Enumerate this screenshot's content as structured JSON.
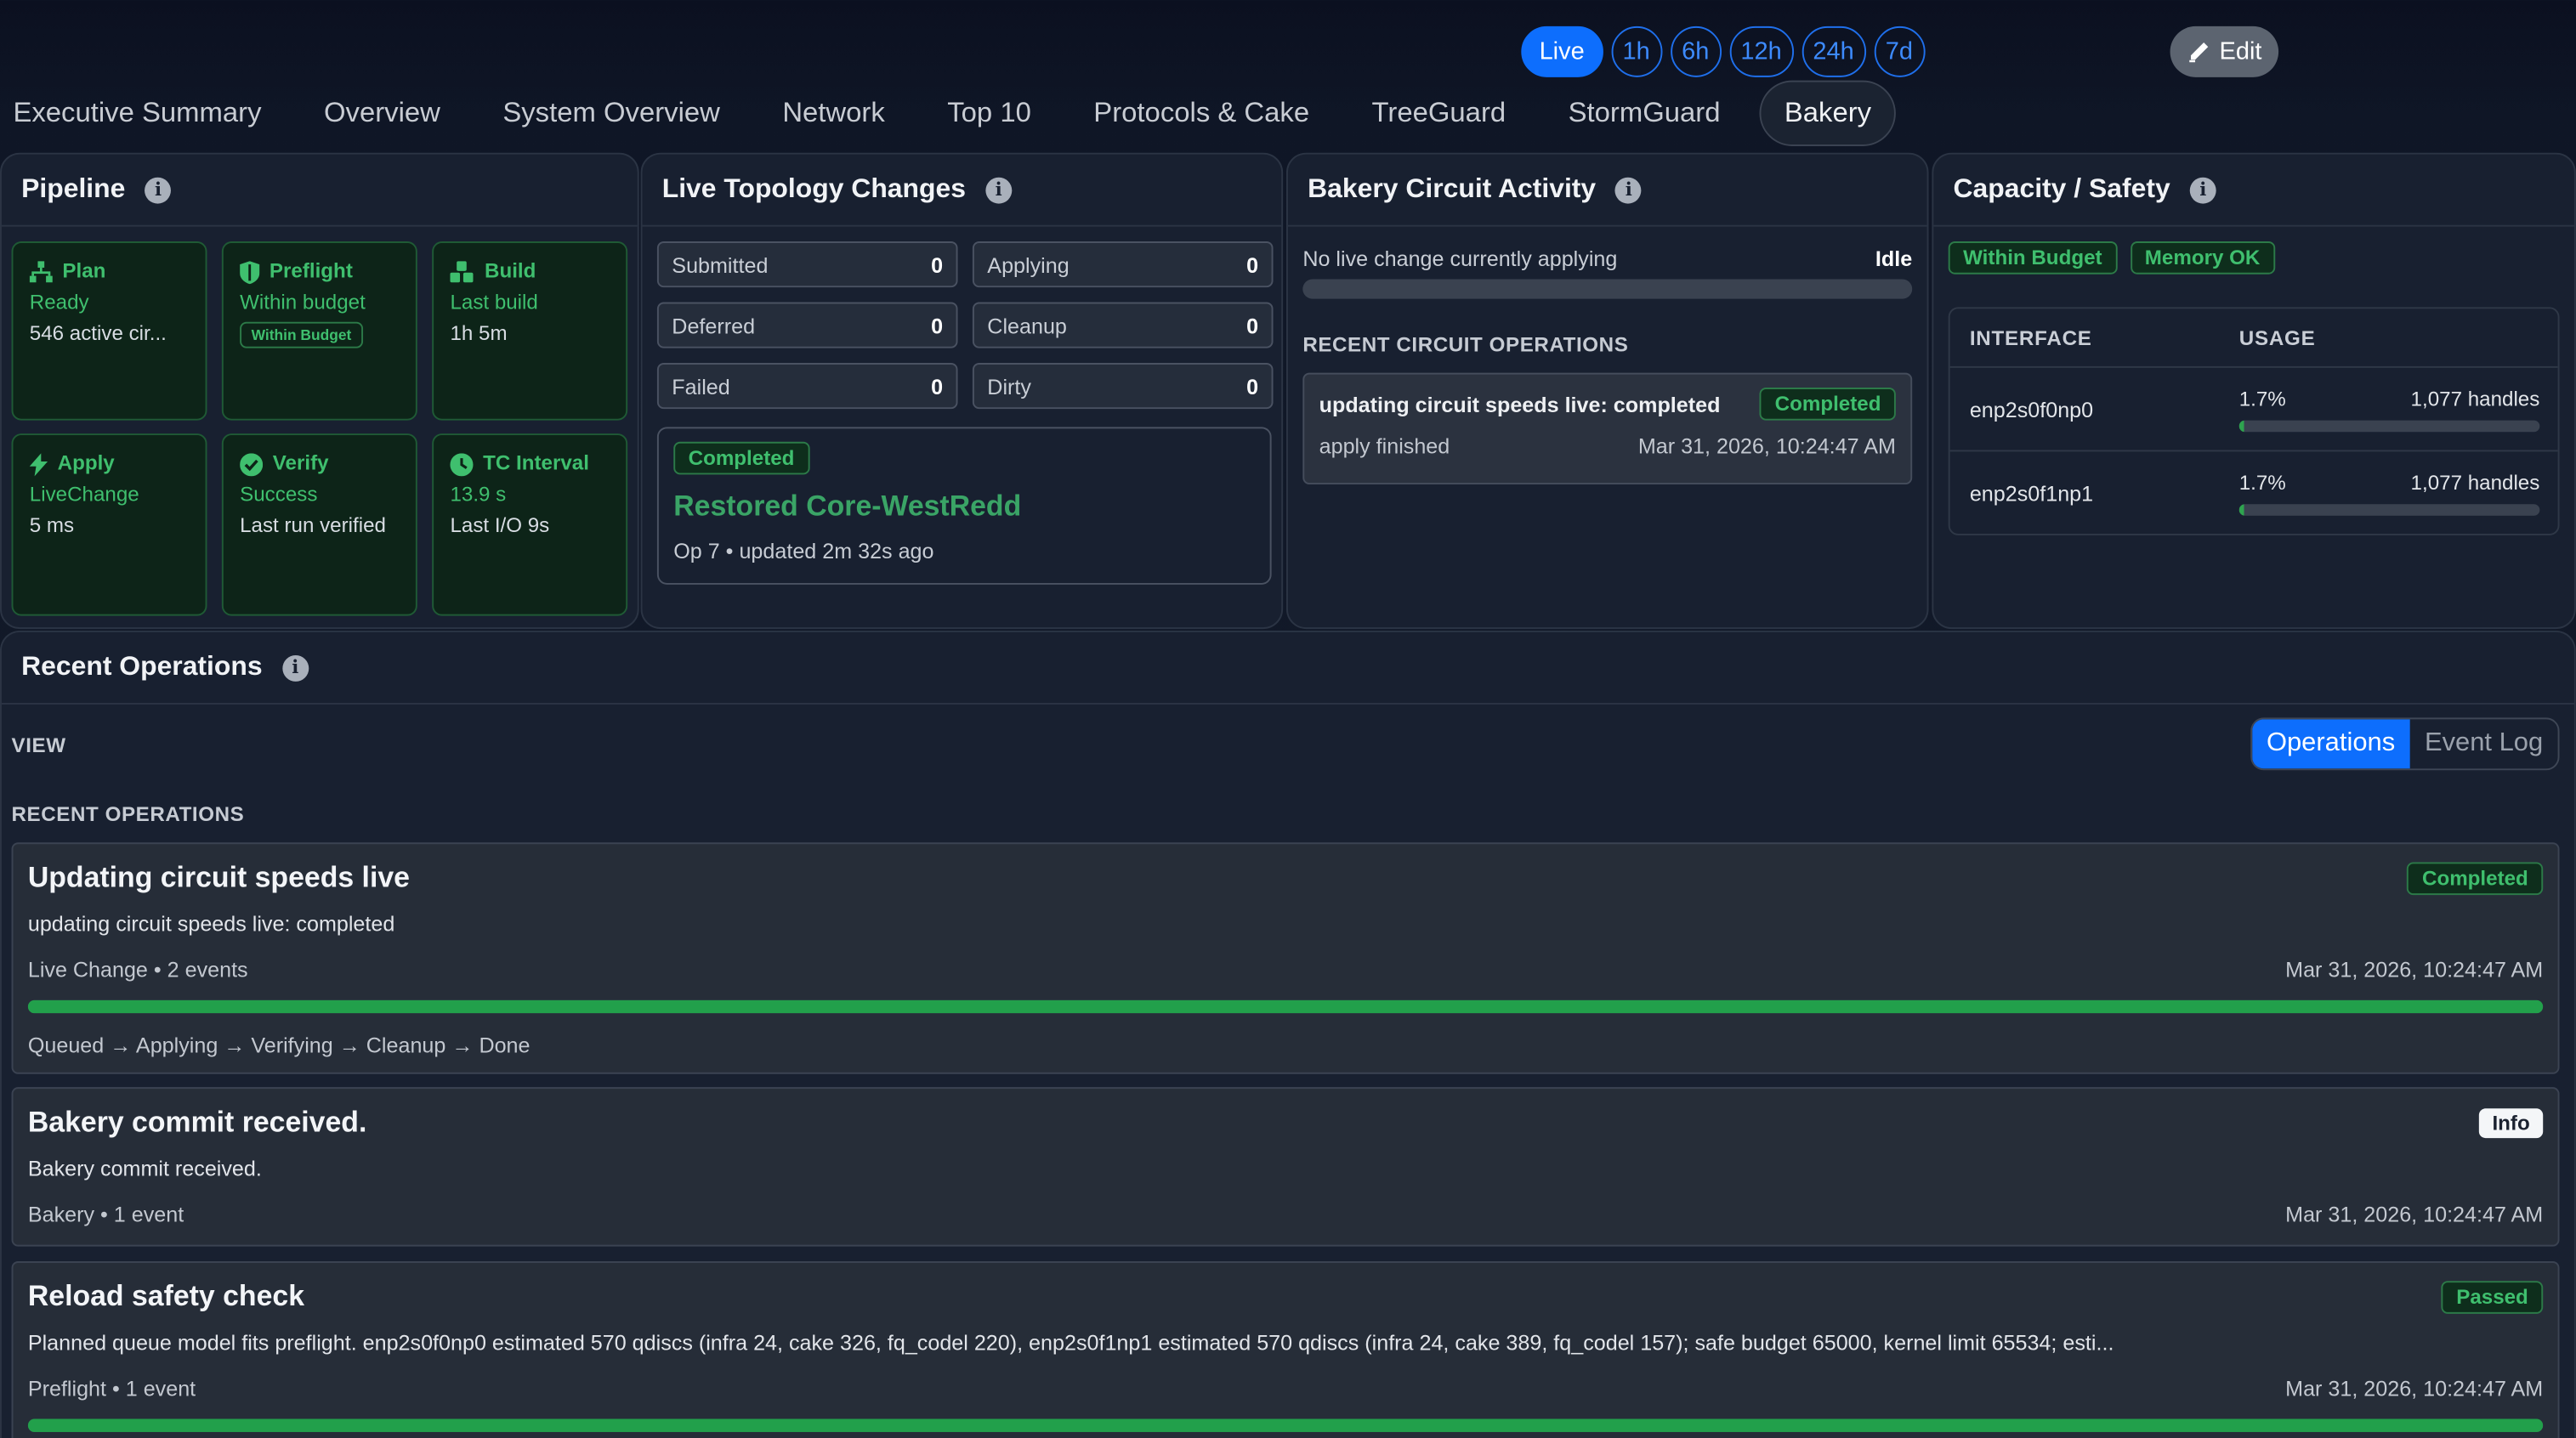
{
  "range": {
    "buttons": [
      "Live",
      "1h",
      "6h",
      "12h",
      "24h",
      "7d"
    ]
  },
  "edit_label": "Edit",
  "tabs": [
    "Executive Summary",
    "Overview",
    "System Overview",
    "Network",
    "Top 10",
    "Protocols & Cake",
    "TreeGuard",
    "StormGuard",
    "Bakery"
  ],
  "pipeline": {
    "title": "Pipeline",
    "steps": [
      {
        "title": "Plan",
        "status": "Ready",
        "detail": "546 active cir..."
      },
      {
        "title": "Preflight",
        "status": "Within budget",
        "badge": "Within Budget"
      },
      {
        "title": "Build",
        "status": "Last build",
        "detail": "1h 5m"
      },
      {
        "title": "Apply",
        "status": "LiveChange",
        "detail": "5 ms"
      },
      {
        "title": "Verify",
        "status": "Success",
        "detail": "Last run verified"
      },
      {
        "title": "TC Interval",
        "status": "13.9 s",
        "detail": "Last I/O 9s"
      }
    ]
  },
  "topology": {
    "title": "Live Topology Changes",
    "cells": [
      {
        "label": "Submitted",
        "value": "0"
      },
      {
        "label": "Applying",
        "value": "0"
      },
      {
        "label": "Deferred",
        "value": "0"
      },
      {
        "label": "Cleanup",
        "value": "0"
      },
      {
        "label": "Failed",
        "value": "0"
      },
      {
        "label": "Dirty",
        "value": "0"
      }
    ],
    "op": {
      "badge": "Completed",
      "title": "Restored Core-WestRedd",
      "meta": "Op 7 • updated 2m 32s ago"
    }
  },
  "circuit": {
    "title": "Bakery Circuit Activity",
    "status_text": "No live change currently applying",
    "status": "Idle",
    "section": "RECENT CIRCUIT OPERATIONS",
    "op": {
      "title": "updating circuit speeds live: completed",
      "badge": "Completed",
      "detail": "apply finished",
      "time": "Mar 31, 2026, 10:24:47 AM"
    }
  },
  "capacity": {
    "title": "Capacity / Safety",
    "badges": [
      "Within Budget",
      "Memory OK"
    ],
    "headers": [
      "INTERFACE",
      "USAGE"
    ],
    "rows": [
      {
        "iface": "enp2s0f0np0",
        "pct": "1.7%",
        "handles": "1,077 handles",
        "fill": 0.017
      },
      {
        "iface": "enp2s0f1np1",
        "pct": "1.7%",
        "handles": "1,077 handles",
        "fill": 0.017
      }
    ]
  },
  "recent": {
    "title": "Recent Operations",
    "view_label": "VIEW",
    "seg": [
      "Operations",
      "Event Log"
    ],
    "section": "RECENT OPERATIONS",
    "ops": [
      {
        "title": "Updating circuit speeds live",
        "badge": "Completed",
        "desc": "updating circuit speeds live: completed",
        "meta": "Live Change • 2 events",
        "time": "Mar 31, 2026, 10:24:47 AM",
        "progress": 1.0,
        "flow": "Queued → Applying → Verifying → Cleanup → Done"
      },
      {
        "title": "Bakery commit received.",
        "badge": "Info",
        "desc": "Bakery commit received.",
        "meta": "Bakery • 1 event",
        "time": "Mar 31, 2026, 10:24:47 AM"
      },
      {
        "title": "Reload safety check",
        "badge": "Passed",
        "desc": "Planned queue model fits preflight. enp2s0f0np0 estimated 570 qdiscs (infra 24, cake 326, fq_codel 220), enp2s0f1np1 estimated 570 qdiscs (infra 24, cake 389, fq_codel 157); safe budget 65000, kernel limit 65534; esti...",
        "meta": "Preflight • 1 event",
        "time": "Mar 31, 2026, 10:24:47 AM",
        "progress": 1.0
      }
    ]
  }
}
